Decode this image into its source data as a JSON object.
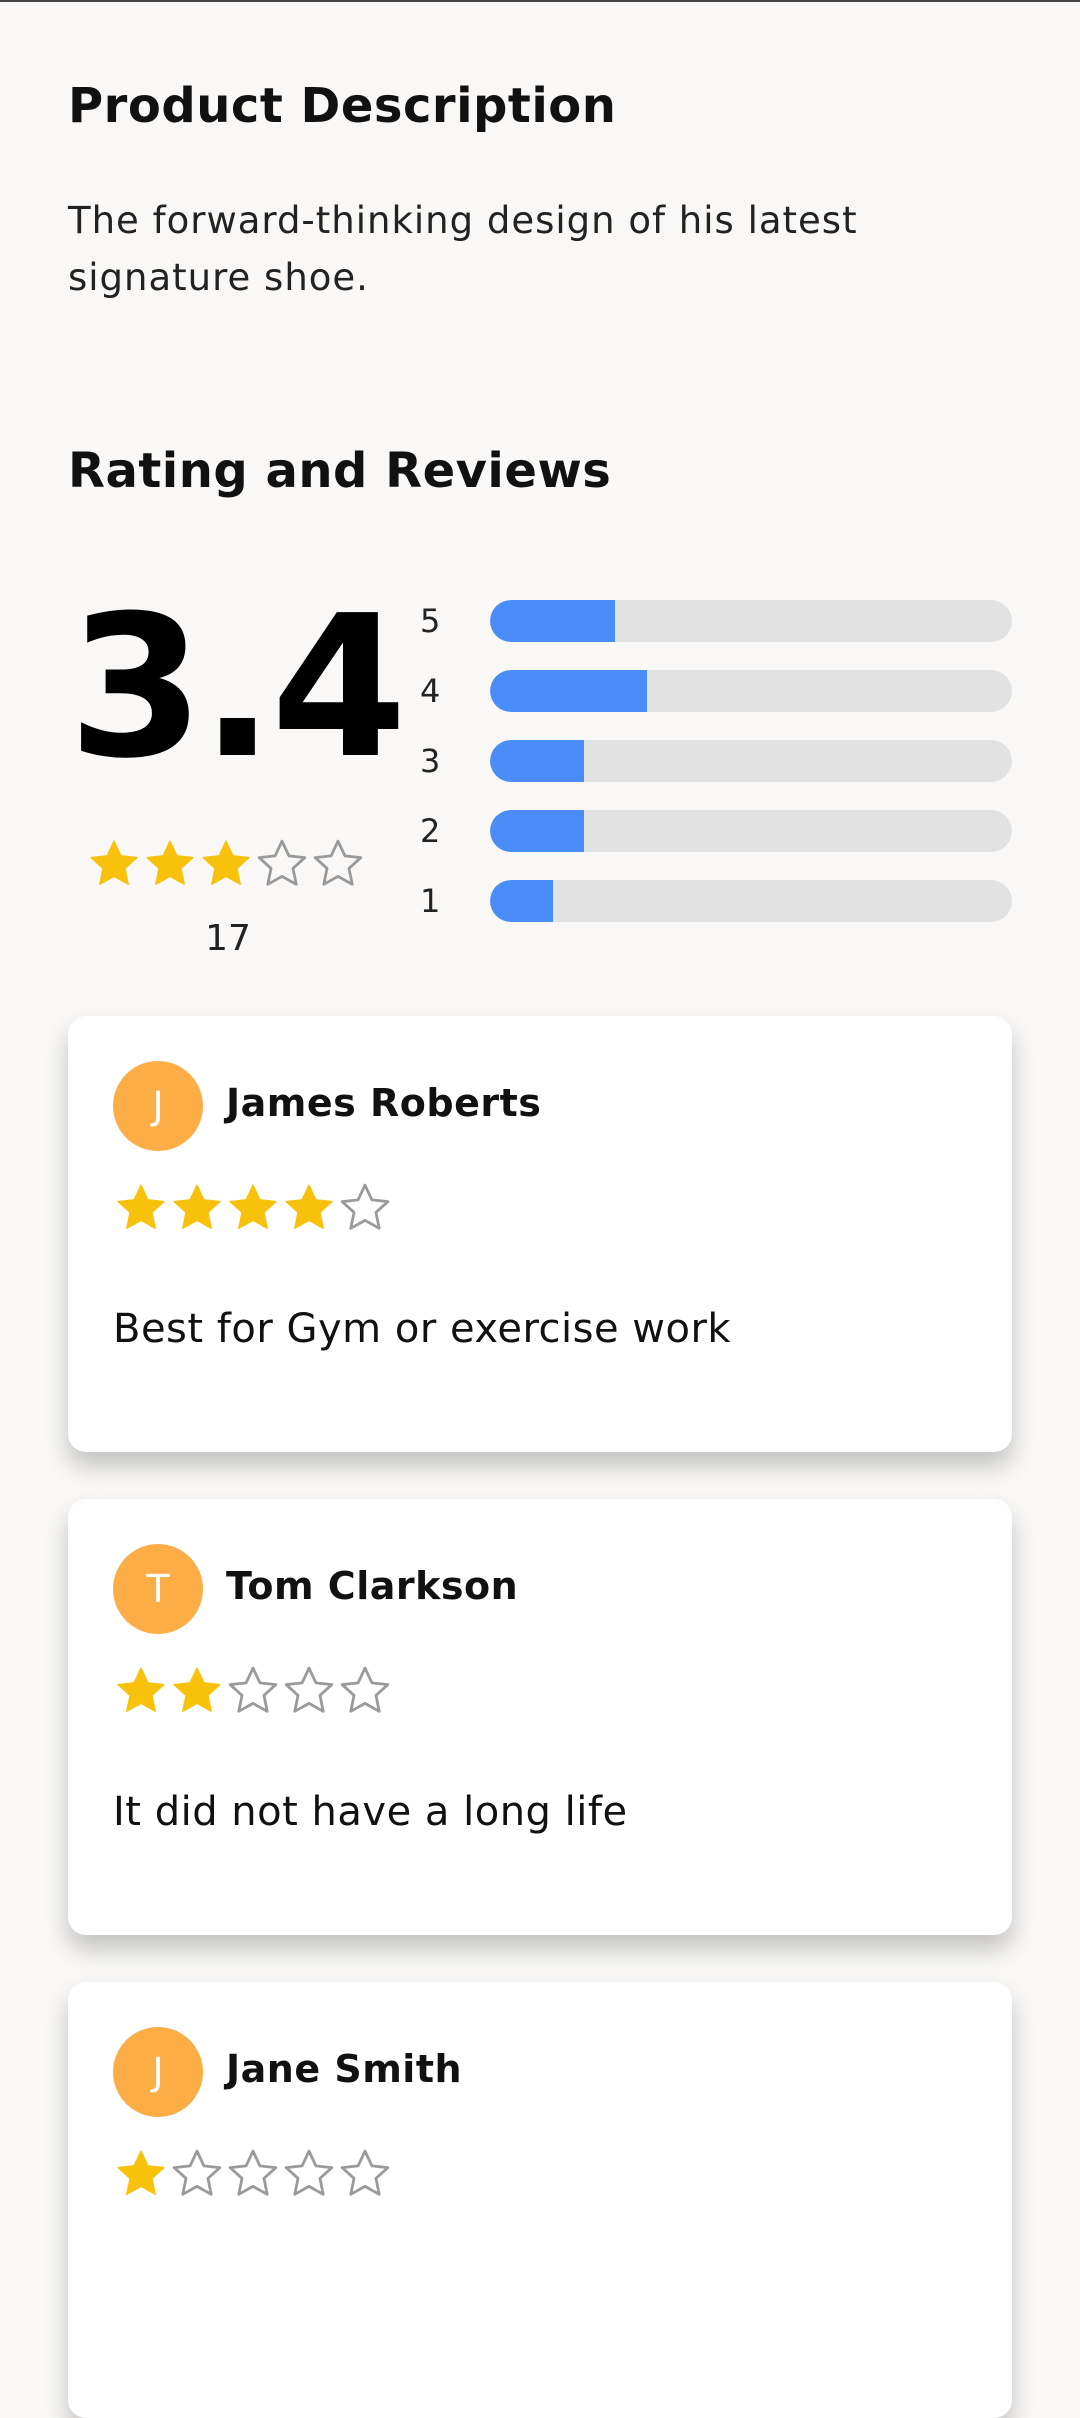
{
  "description": {
    "title": "Product Description",
    "text": "The forward-thinking design of his latest signature shoe."
  },
  "ratings": {
    "title": "Rating and Reviews",
    "average": "3.4",
    "average_stars": 3,
    "count": "17",
    "bars": [
      {
        "label": "5",
        "fraction": 0.24
      },
      {
        "label": "4",
        "fraction": 0.3
      },
      {
        "label": "3",
        "fraction": 0.18
      },
      {
        "label": "2",
        "fraction": 0.18
      },
      {
        "label": "1",
        "fraction": 0.12
      }
    ]
  },
  "reviews": [
    {
      "initial": "J",
      "name": "James Roberts",
      "stars": 4,
      "text": "Best for Gym or exercise work"
    },
    {
      "initial": "T",
      "name": "Tom Clarkson",
      "stars": 2,
      "text": "It did not have a long life"
    },
    {
      "initial": "J",
      "name": "Jane Smith",
      "stars": 1,
      "text": ""
    }
  ],
  "colors": {
    "star_filled": "#f8c20c",
    "star_empty": "#9a9a9a",
    "bar_fill": "#4a8df8",
    "bar_track": "#e2e2e2",
    "avatar_bg": "#fcad45"
  },
  "icons": {
    "star_filled": "star-filled-icon",
    "star_empty": "star-outline-icon"
  }
}
